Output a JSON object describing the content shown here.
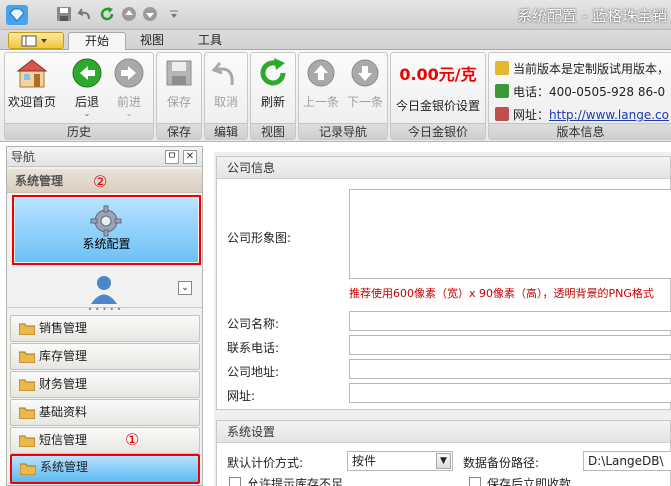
{
  "window": {
    "title": "系统配置 - 蓝格珠宝销"
  },
  "tabs": [
    "开始",
    "视图",
    "工具"
  ],
  "ribbon": {
    "history": {
      "label": "历史",
      "home": "欢迎首页",
      "back": "后退",
      "forward": "前进"
    },
    "save": {
      "label": "保存",
      "save": "保存"
    },
    "edit": {
      "label": "编辑",
      "cancel": "取消"
    },
    "view": {
      "label": "视图",
      "refresh": "刷新"
    },
    "record": {
      "label": "记录导航",
      "prev": "上一条",
      "next": "下一条"
    },
    "gold": {
      "label": "今日金银价",
      "price": "0.00元/克",
      "setting": "今日金银价设置"
    },
    "version": {
      "label": "版本信息",
      "notice": "当前版本是定制版试用版本，",
      "phone_label": "电话：",
      "phone": "400-0505-928  86-0",
      "site_label": "网址：",
      "site": "http://www.lange.co"
    }
  },
  "nav": {
    "title": "导航",
    "pin": "ㅁ",
    "close": "✕",
    "section": "系统管理",
    "marker2": "②",
    "config_button": "系统配置",
    "items": [
      "销售管理",
      "库存管理",
      "财务管理",
      "基础资料",
      "短信管理",
      "系统管理"
    ],
    "marker1": "①"
  },
  "company": {
    "title": "公司信息",
    "image_label": "公司形象图:",
    "image_hint": "推荐使用600像素（宽）x 90像素（高），透明背景的PNG格式",
    "name_label": "公司名称:",
    "phone_label": "联系电话:",
    "address_label": "公司地址:",
    "site_label": "网址:"
  },
  "system": {
    "title": "系统设置",
    "pricing_label": "默认计价方式:",
    "pricing_value": "按件",
    "backup_label": "数据备份路径:",
    "backup_value": "D:\\LangeDB\\",
    "stock_prompt": "允许提示库存不足",
    "auto_save": "保存后立即收款"
  },
  "colors": {
    "accent": "#6cc1f6",
    "highlight_border": "#e00000",
    "gold_price": "#e00000"
  }
}
